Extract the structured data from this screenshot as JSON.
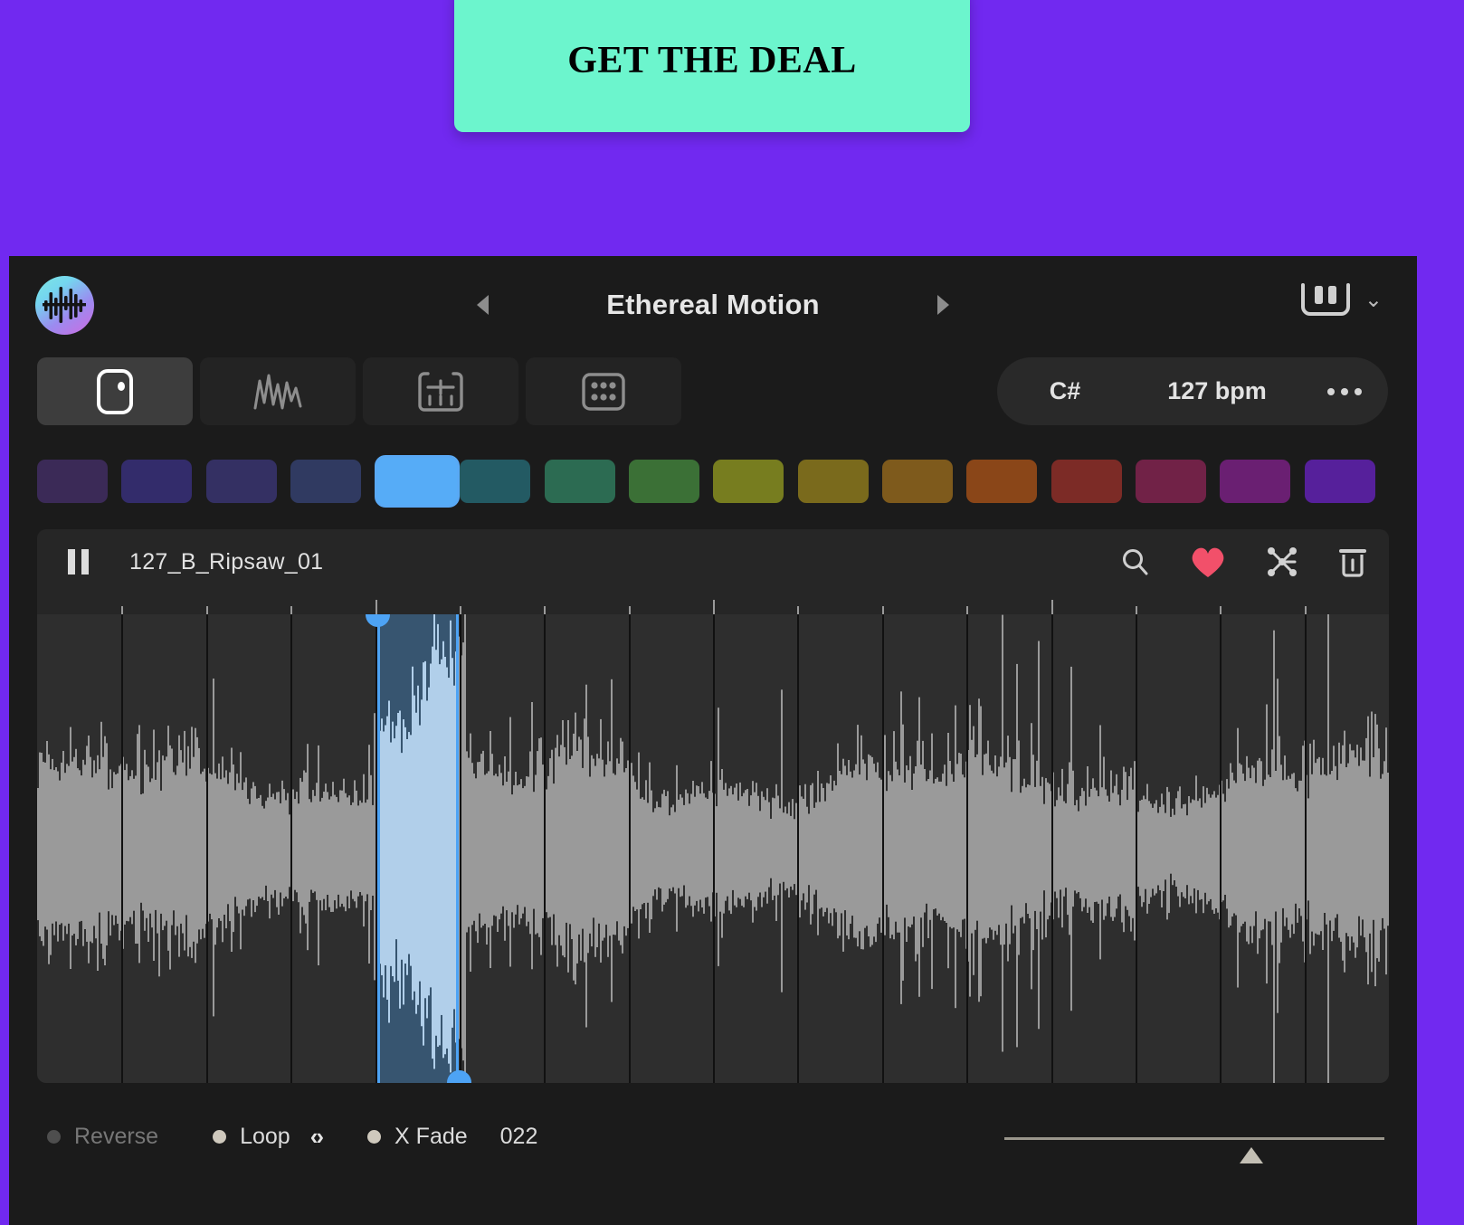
{
  "promo": {
    "button_label": "GET THE DEAL",
    "banner_color": "#7129f0",
    "button_color": "#6cf5cd"
  },
  "header": {
    "logo_name": "app-logo",
    "preset_title": "Ethereal Motion",
    "prev_label": "◀",
    "next_label": "▶",
    "keyboard_icon": "piano-keys-icon",
    "chevron": "⌄"
  },
  "tabs": [
    {
      "id": "pad",
      "icon": "sample-pad-icon",
      "active": true
    },
    {
      "id": "waveform",
      "icon": "waveform-icon",
      "active": false
    },
    {
      "id": "mixer",
      "icon": "mixer-faders-icon",
      "active": false
    },
    {
      "id": "grid",
      "icon": "pad-grid-icon",
      "active": false
    }
  ],
  "transport": {
    "key": "C#",
    "bpm": "127 bpm",
    "more_label": "•••"
  },
  "swatches": {
    "selected_index": 4,
    "colors": [
      "#3b2a57",
      "#332c6b",
      "#343063",
      "#303a61",
      "#56acf7",
      "#235a63",
      "#2c6b52",
      "#3b7036",
      "#777d1f",
      "#7a6a1c",
      "#7e5a1c",
      "#8a4618",
      "#7c2b26",
      "#712247",
      "#6a1f72",
      "#56209b"
    ]
  },
  "sample": {
    "name": "127_B_Ripsaw_01",
    "play_state": "paused",
    "play_icon": "pause-icon",
    "icons": [
      {
        "name": "search-icon",
        "color": "#cfcfcf"
      },
      {
        "name": "heart-icon",
        "color": "#f2506a"
      },
      {
        "name": "shuffle-nodes-icon",
        "color": "#d2d2d2"
      },
      {
        "name": "trash-icon",
        "color": "#cfcfcf"
      }
    ]
  },
  "waveform": {
    "selection_start_pct": 25.2,
    "selection_end_pct": 31.2,
    "selection_color": "#4da3f5",
    "wave_color": "#9a9a9a",
    "wave_color_selected": "#ffffff",
    "background": "#2e2e2e",
    "grid_count": 16
  },
  "bottom": {
    "reverse_label": "Reverse",
    "reverse_on": false,
    "loop_label": "Loop",
    "loop_on": true,
    "loop_arrows": "‹›",
    "xfade_label": "X Fade",
    "xfade_on": true,
    "xfade_value": "022",
    "slider_value_pct": 65
  }
}
